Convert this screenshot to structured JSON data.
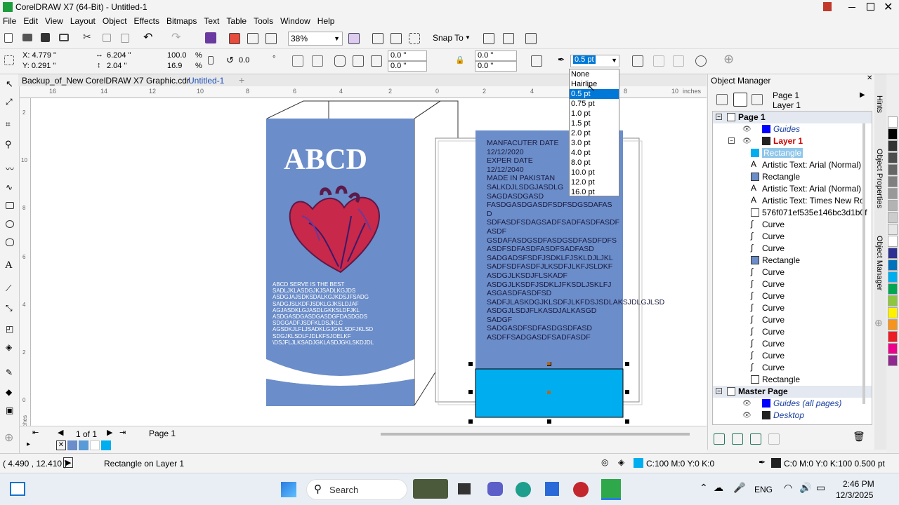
{
  "app": {
    "title": "CorelDRAW X7 (64-Bit) - Untitled-1"
  },
  "menu": [
    "File",
    "Edit",
    "View",
    "Layout",
    "Object",
    "Effects",
    "Bitmaps",
    "Text",
    "Table",
    "Tools",
    "Window",
    "Help"
  ],
  "toolbar": {
    "zoom": "38%",
    "snap": "Snap To"
  },
  "props": {
    "x": "X: 4.779 \"",
    "y": "Y: 0.291 \"",
    "w": "6.204 \"",
    "h": "2.04 \"",
    "sx": "100.0",
    "sy": "16.9",
    "pct": "%",
    "rot": "0.0",
    "deg": "°",
    "c1": "0.0 \"",
    "c2": "0.0 \"",
    "c3": "0.0 \"",
    "c4": "0.0 \"",
    "outline": "0.5 pt"
  },
  "tabs": [
    "Backup_of_New CorelDRAW X7 Graphic.cdr",
    "Untitled-1"
  ],
  "ruler": {
    "h": [
      "16",
      "14",
      "12",
      "10",
      "8",
      "6",
      "4",
      "2",
      "0",
      "2",
      "4",
      "6",
      "8",
      "10",
      "inches"
    ],
    "v": [
      "2",
      "10",
      "8",
      "6",
      "4",
      "2",
      "0"
    ],
    "v_unit": "inches"
  },
  "outline_dropdown": [
    "None",
    "Hairline",
    "0.5 pt",
    "0.75 pt",
    "1.0 pt",
    "1.5 pt",
    "2.0 pt",
    "3.0 pt",
    "4.0 pt",
    "8.0 pt",
    "10.0 pt",
    "12.0 pt",
    "16.0 pt"
  ],
  "doc": {
    "front_title": "ABCD",
    "front_text": "ABCD SERVE IS THE BEST\nSADLJKLASDGJKJSADLKGJDS\nASDGJAJSDKSDALKGJKDSJFSADG\nSADGJSLKDFJSDKLGJKSLDJAF\nAGJASDKLGJASDLGKKSLDFJKL\nASDGASDGASDGASDGFDASDGDS\nSDGGADFJSDFKLDSJKLC\nAGSDKJLFLJSADKLGJGKLSDFJKLSD\nSDGJKLSDLFJDLKFSJOELKF\n\\DSJFLJLKSADJGKLASDJGKLSKDJDL",
    "back_text": "MANFACUTER DATE\n12/12/2020\nEXPER DATE\n12/12/2040\nMADE IN PAKISTAN\nSALKDJLSDGJASDLG\nSAGDASDGASD\nFASDGASDGASDFSDFSDGSDAFAS\nD\nSDFASDFSDAGSADFSADFASDFASDF\nASDF\nGSDAFASDGSDFASDGSDFASDFDFS\nASDFSDFASDFASDFSADFASD\nSADGADSFSDFJSDKLFJSKLDJLJKL\nSADFSDFASDFJLKSDFJLKFJSLDKF\nASDGJLKSDJFLSKADF\nASDGJLKSDFJSDKLJFKSDLJSKLFJ\nASGASDFASDFSD\nSADFJLASKDGJKLSDFJLKFDSJSDLAKSJDLGJLSD\nASDGJLSDJFLKASDJALKASGD\nSADGF\nSADGASDFSDFASDGSDFASD\nASDFFSADGASDFSADFASDF"
  },
  "object_manager": {
    "title": "Object Manager",
    "page": "Page 1",
    "layer": "Layer 1",
    "rows": [
      {
        "label": "Page 1",
        "kind": "page"
      },
      {
        "label": "Guides",
        "kind": "layer-guides"
      },
      {
        "label": "Layer 1",
        "kind": "layer"
      },
      {
        "label": "Rectangle",
        "kind": "rect-selected"
      },
      {
        "label": "Artistic Text: Arial (Normal)",
        "kind": "text"
      },
      {
        "label": "Rectangle",
        "kind": "rect"
      },
      {
        "label": "Artistic Text: Arial (Normal)",
        "kind": "text"
      },
      {
        "label": "Artistic Text: Times New Ro",
        "kind": "text"
      },
      {
        "label": "576f071ef535e146bc3d1b0f",
        "kind": "bitmap"
      },
      {
        "label": "Curve",
        "kind": "curve"
      },
      {
        "label": "Curve",
        "kind": "curve"
      },
      {
        "label": "Curve",
        "kind": "curve"
      },
      {
        "label": "Rectangle",
        "kind": "rect"
      },
      {
        "label": "Curve",
        "kind": "curve"
      },
      {
        "label": "Curve",
        "kind": "curve"
      },
      {
        "label": "Curve",
        "kind": "curve"
      },
      {
        "label": "Curve",
        "kind": "curve"
      },
      {
        "label": "Curve",
        "kind": "curve"
      },
      {
        "label": "Curve",
        "kind": "curve"
      },
      {
        "label": "Curve",
        "kind": "curve"
      },
      {
        "label": "Curve",
        "kind": "curve"
      },
      {
        "label": "Curve",
        "kind": "curve"
      },
      {
        "label": "Rectangle",
        "kind": "rect-white"
      },
      {
        "label": "Master Page",
        "kind": "page"
      },
      {
        "label": "Guides (all pages)",
        "kind": "layer-guides"
      },
      {
        "label": "Desktop",
        "kind": "layer-desktop"
      }
    ],
    "side_tabs": [
      "Hints",
      "Object Properties",
      "Object Manager"
    ]
  },
  "pager": {
    "of": "1 of 1",
    "page": "Page 1"
  },
  "status": {
    "coords": "( 4.490 , 12.410 )",
    "msg": "Rectangle on Layer 1",
    "fill": "C:100 M:0 Y:0 K:0",
    "outline": "C:0 M:0 Y:0 K:100  0.500 pt"
  },
  "taskbar": {
    "search": "Search",
    "lang": "ENG",
    "time": "2:46 PM",
    "date": "12/3/2025"
  },
  "colors": {
    "box_blue": "#6b8dc9",
    "cyan": "#00aeef",
    "heart_red": "#c8284a"
  },
  "palette": [
    "#ffffff",
    "#000000",
    "#333333",
    "#4d4d4d",
    "#666666",
    "#808080",
    "#999999",
    "#b3b3b3",
    "#cccccc",
    "#e6e6e6",
    "#ffffff",
    "#2e3192",
    "#0072bc",
    "#00aeef",
    "#00a651",
    "#8dc63f",
    "#fff200",
    "#f7941d",
    "#ed1c24",
    "#ec008c",
    "#92278f"
  ]
}
